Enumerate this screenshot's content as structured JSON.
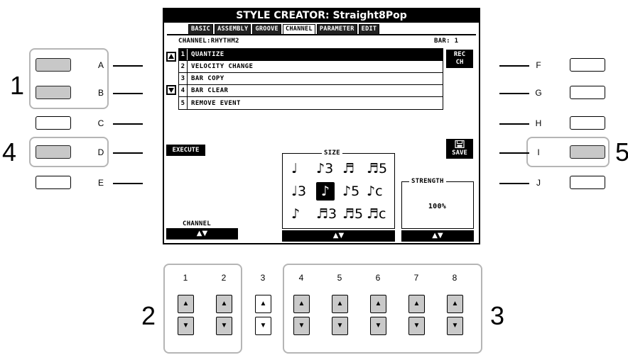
{
  "screen": {
    "title": "STYLE CREATOR: Straight8Pop",
    "tabs": [
      "BASIC",
      "ASSEMBLY",
      "GROOVE",
      "CHANNEL",
      "PARAMETER",
      "EDIT"
    ],
    "active_tab": "CHANNEL",
    "channel_label": "CHANNEL:RHYTHM2",
    "bar_label": "BAR:  1",
    "jobs": [
      {
        "num": "1",
        "label": "QUANTIZE",
        "selected": true
      },
      {
        "num": "2",
        "label": "VELOCITY CHANGE",
        "selected": false
      },
      {
        "num": "3",
        "label": "BAR COPY",
        "selected": false
      },
      {
        "num": "4",
        "label": "BAR CLEAR",
        "selected": false
      },
      {
        "num": "5",
        "label": "REMOVE EVENT",
        "selected": false
      }
    ],
    "rec_ch": {
      "line1": "REC",
      "line2": "CH"
    },
    "execute_label": "EXECUTE",
    "save_label": "SAVE",
    "size_label": "SIZE",
    "strength_label": "STRENGTH",
    "strength_value": "100%",
    "channel_dial_label": "CHANNEL",
    "dial_arrows": "▲▼",
    "note_grid": [
      [
        "♩",
        "♪3",
        "♬",
        "♬5"
      ],
      [
        "♩3",
        "♪",
        "♪5",
        "♪c"
      ],
      [
        "♪",
        "♬3",
        "♬5",
        "♬c"
      ]
    ]
  },
  "left_buttons": [
    "A",
    "B",
    "C",
    "D",
    "E"
  ],
  "right_buttons": [
    "F",
    "G",
    "H",
    "I",
    "J"
  ],
  "pressed_buttons": [
    "A",
    "B",
    "D",
    "I"
  ],
  "callouts": {
    "c1": "1",
    "c2": "2",
    "c3": "3",
    "c4": "4",
    "c5": "5"
  },
  "lower_buttons": [
    "1",
    "2",
    "3",
    "4",
    "5",
    "6",
    "7",
    "8"
  ],
  "arrows": {
    "up": "▲",
    "down": "▼"
  }
}
